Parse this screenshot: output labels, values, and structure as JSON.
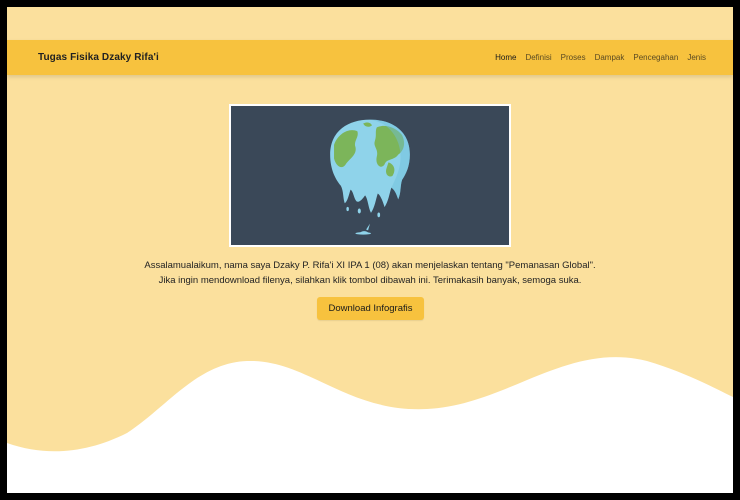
{
  "navbar": {
    "brand": "Tugas Fisika Dzaky Rifa'i",
    "links": [
      "Home",
      "Definisi",
      "Proses",
      "Dampak",
      "Pencegahan",
      "Jenis"
    ],
    "active": "Home"
  },
  "hero": {
    "image": "melting-earth-illustration",
    "line1": "Assalamualaikum, nama saya Dzaky P. Rifa'i XI IPA 1 (08) akan menjelaskan tentang \"Pemanasan Global\".",
    "line2": "Jika ingin mendownload filenya, silahkan klik tombol dibawah ini. Terimakasih banyak, semoga suka.",
    "download_label": "Download Infografis"
  },
  "colors": {
    "background": "#fbe09d",
    "navbar": "#f7c23e",
    "image_bg": "#3a4858",
    "button": "#f7c23e"
  }
}
